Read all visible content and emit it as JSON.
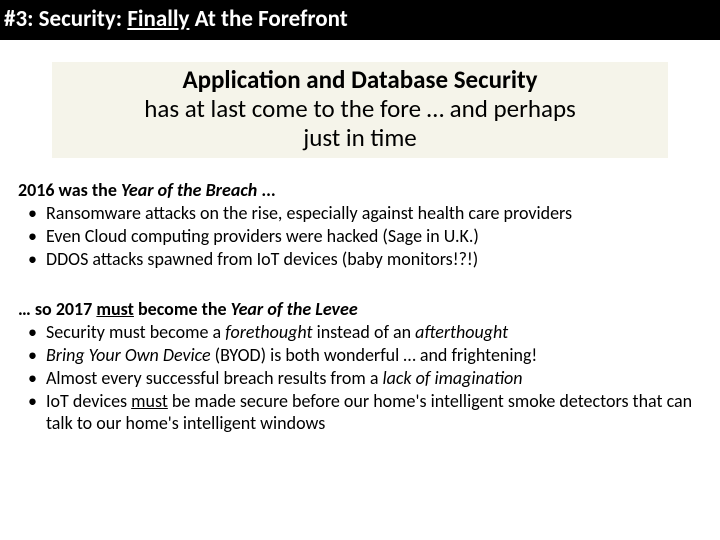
{
  "title": {
    "prefix": "#3: Security: ",
    "underlined": "Finally",
    "suffix": " At the Forefront"
  },
  "subhead": {
    "bold": "Application and Database Security",
    "line2a": "has at last come to the fore … and perhaps",
    "line2b": "just in time"
  },
  "section1": {
    "lead_b1": "2016 was the ",
    "lead_i1": "Year of the Breach",
    "lead_b2": " ...",
    "bullets": [
      "Ransomware attacks on the rise, especially against health care providers",
      "Even Cloud computing providers were hacked (Sage in U.K.)",
      "DDOS attacks spawned from IoT devices (baby monitors!?!)"
    ]
  },
  "section2": {
    "lead_pre": "… so ",
    "lead_b_pre": "2017 ",
    "lead_u": "must",
    "lead_b_post": " become the ",
    "lead_i": "Year of the Levee",
    "bullets": {
      "b0_a": "Security must become a ",
      "b0_i1": "forethought",
      "b0_b": " instead of an ",
      "b0_i2": "afterthought",
      "b1_i": "Bring Your Own Device",
      "b1_rest": " (BYOD) is both wonderful … and frightening!",
      "b2_a": "Almost every successful breach results from a ",
      "b2_i": "lack of imagination",
      "b3_a": "IoT devices ",
      "b3_u": "must",
      "b3_b": " be made secure before our home's intelligent smoke detectors that can talk to our home's intelligent windows"
    }
  }
}
